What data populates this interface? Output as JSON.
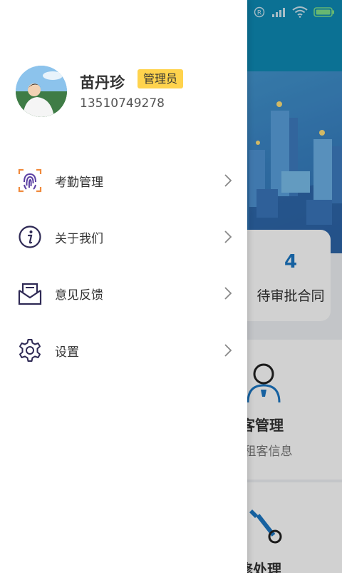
{
  "user": {
    "name": "苗丹珍",
    "role": "管理员",
    "phone": "13510749278"
  },
  "menu": {
    "items": [
      {
        "label": "考勤管理",
        "icon": "fingerprint-icon"
      },
      {
        "label": "关于我们",
        "icon": "info-icon"
      },
      {
        "label": "意见反馈",
        "icon": "envelope-icon"
      },
      {
        "label": "设置",
        "icon": "gear-icon"
      }
    ]
  },
  "background": {
    "pending_count": "4",
    "pending_label": "待审批合同",
    "tile1_title": "客管理",
    "tile1_subtitle": "理租客信息",
    "tile2_title": "修处理"
  },
  "colors": {
    "accent": "#1b77c4",
    "header": "#0e8ab5",
    "badge": "#ffd34d"
  }
}
